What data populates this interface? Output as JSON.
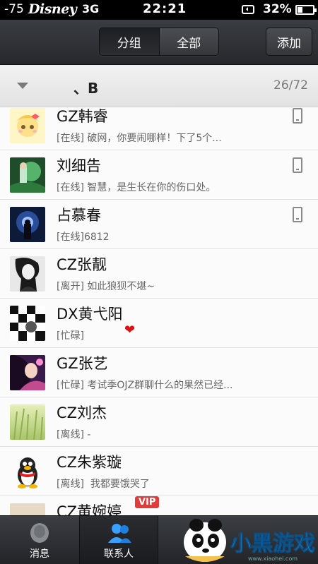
{
  "status_bar": {
    "signal": "-75",
    "carrier": "Disney",
    "network": "3G",
    "time": "22:21",
    "battery_percent": "32%",
    "battery_level": 0.32
  },
  "header": {
    "tabs": [
      {
        "label": "分组",
        "active": true
      },
      {
        "label": "全部",
        "active": false
      }
    ],
    "add_label": "添加"
  },
  "group": {
    "name": "、B",
    "count": "26/72"
  },
  "contacts": [
    {
      "name": "GZ韩睿",
      "status": "[在线]",
      "signature": "破网，你要闹哪样！下了5个...",
      "mobile": true
    },
    {
      "name": "刘细告",
      "status": "[在线]",
      "signature": "智慧，是生长在你的伤口处。",
      "mobile": true
    },
    {
      "name": "占慕春",
      "status": "[在线]",
      "signature": "6812",
      "mobile": true
    },
    {
      "name": "CZ张靓",
      "status": "[离开]",
      "signature": "如此狼狈不堪~",
      "mobile": false
    },
    {
      "name": "DX黄弋阳",
      "status": "[忙碌]",
      "signature": "",
      "mobile": false,
      "heart": "❤"
    },
    {
      "name": "GZ张艺",
      "status": "[忙碌]",
      "signature": "考试季OJZ群聊什么的果然已经...",
      "mobile": false
    },
    {
      "name": "CZ刘杰",
      "status": "[离线]",
      "signature": "-",
      "mobile": false
    },
    {
      "name": "CZ朱紫璇",
      "status": "[离线]",
      "signature": "  我都要饿哭了",
      "mobile": false
    },
    {
      "name": "CZ黄婉婷",
      "status": "",
      "signature": "",
      "mobile": false,
      "vip": "VIP"
    }
  ],
  "tabbar": {
    "tabs": [
      {
        "label": "消息",
        "icon": "chat-bubble-icon",
        "active": false
      },
      {
        "label": "联系人",
        "icon": "contacts-icon",
        "active": true
      }
    ]
  },
  "watermark": {
    "text": "小黑游戏",
    "url": "www.xiaohei.com"
  },
  "colors": {
    "header_bg": "#2f3237",
    "list_bg": "#fbfbfb",
    "heart": "#dd1111",
    "vip": "#e23b3b"
  }
}
